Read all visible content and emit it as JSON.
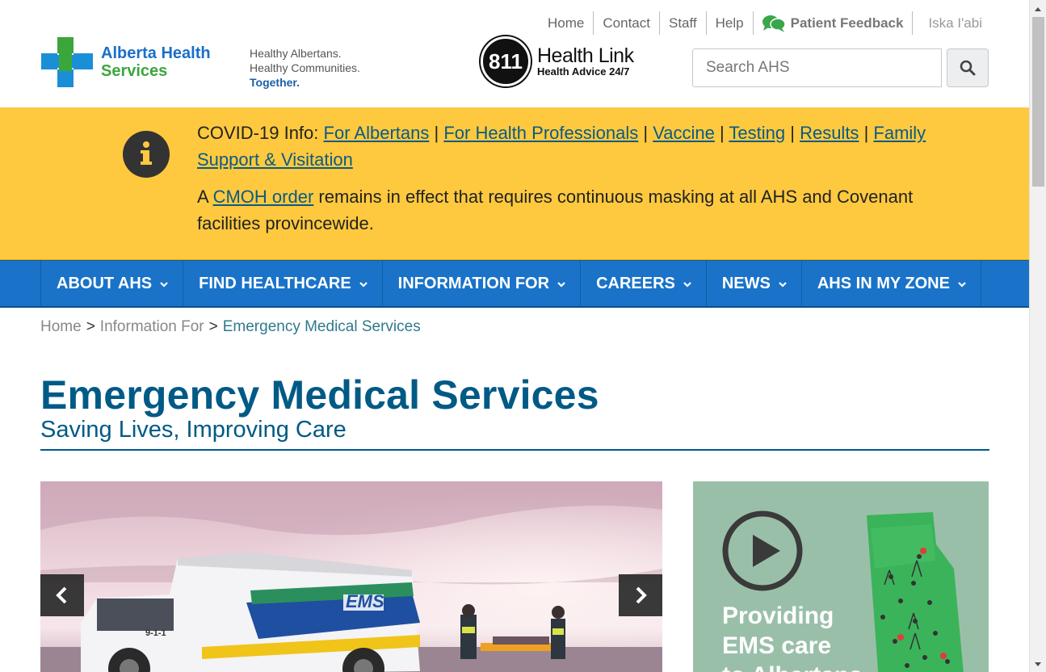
{
  "header": {
    "utility_links": [
      "Home",
      "Contact",
      "Staff",
      "Help"
    ],
    "feedback_label": "Patient Feedback",
    "language_link": "Iska I'abi",
    "logo": {
      "line1": "Alberta Health",
      "line2": "Services"
    },
    "tagline": {
      "line1": "Healthy Albertans.",
      "line2": "Healthy Communities.",
      "line3": "Together."
    },
    "healthlink": {
      "number": "811",
      "title": "Health Link",
      "subtitle": "Health Advice 24/7"
    },
    "search": {
      "placeholder": "Search AHS"
    }
  },
  "alert": {
    "covid_prefix": "COVID-19 Info:",
    "links": [
      "For Albertans",
      "For Health Professionals",
      "Vaccine",
      "Testing",
      "Results",
      "Family Support & Visitation"
    ],
    "separator": "|",
    "masking_prefix": "A",
    "masking_link": "CMOH order",
    "masking_suffix": "remains in effect that requires continuous masking at all AHS and Covenant facilities provincewide."
  },
  "nav": {
    "items": [
      "ABOUT AHS",
      "FIND HEALTHCARE",
      "INFORMATION FOR",
      "CAREERS",
      "NEWS",
      "AHS IN MY ZONE"
    ]
  },
  "breadcrumb": {
    "home": "Home",
    "parent": "Information For",
    "current": "Emergency Medical Services",
    "separator": ">"
  },
  "page": {
    "title": "Emergency Medical Services",
    "subtitle": "Saving Lives, Improving Care"
  },
  "carousel": {
    "ambulance_label": "EMS",
    "phone_label": "9-1-1"
  },
  "promo": {
    "line1": "Providing",
    "line2": "EMS care",
    "line3": "to Albertans"
  },
  "colors": {
    "brand_blue": "#1a73c8",
    "alert_yellow": "#fec93e",
    "title_teal": "#005a86",
    "promo_green": "#9abfa9"
  }
}
